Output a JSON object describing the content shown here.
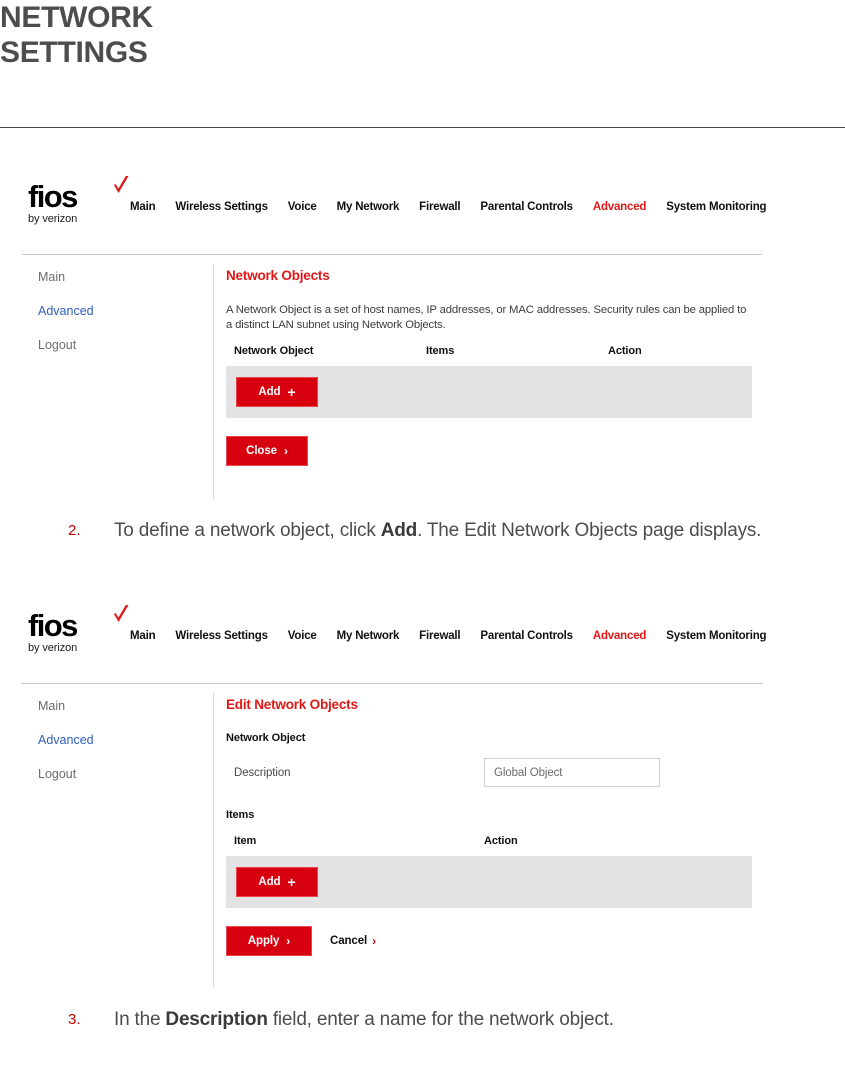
{
  "page": {
    "title_line1": "NETWORK",
    "title_line2": "SETTINGS"
  },
  "router_ui": {
    "logo": {
      "wordmark": "fios",
      "subtext": "by verizon",
      "check_icon": "verizon-check-icon",
      "check_color": "#e01717"
    },
    "nav_items": [
      {
        "label": "Main",
        "active": false
      },
      {
        "label": "Wireless Settings",
        "active": false
      },
      {
        "label": "Voice",
        "active": false
      },
      {
        "label": "My Network",
        "active": false
      },
      {
        "label": "Firewall",
        "active": false
      },
      {
        "label": "Parental Controls",
        "active": false
      },
      {
        "label": "Advanced",
        "active": true
      },
      {
        "label": "System Monitoring",
        "active": false
      }
    ],
    "sidebar_items": [
      {
        "label": "Main",
        "active": false
      },
      {
        "label": "Advanced",
        "active": true
      },
      {
        "label": "Logout",
        "active": false
      }
    ],
    "accent_red": "#e01717",
    "button_red": "#d7000f",
    "active_link_blue": "#2f5fbf",
    "panel_gray": "#e3e3e3"
  },
  "screen1": {
    "title": "Network Objects",
    "description": "A Network Object is a set of host names, IP addresses, or MAC addresses. Security rules can be applied to a distinct LAN subnet using Network Objects.",
    "columns": [
      "Network Object",
      "Items",
      "Action"
    ],
    "rows": [],
    "add_label": "Add",
    "add_icon": "plus-icon",
    "close_label": "Close",
    "close_icon": "chevron-right-icon"
  },
  "screen2": {
    "title": "Edit Network Objects",
    "section_label": "Network Object",
    "description_field_label": "Description",
    "description_field_value": "Global Object",
    "description_field_placeholder": "Global Object",
    "items_label": "Items",
    "columns": [
      "Item",
      "Action"
    ],
    "rows": [],
    "add_label": "Add",
    "add_icon": "plus-icon",
    "apply_label": "Apply",
    "apply_icon": "chevron-right-icon",
    "cancel_label": "Cancel",
    "cancel_icon": "chevron-right-icon"
  },
  "steps": [
    {
      "number": "2.",
      "text_before": "To define a network object, click ",
      "bold": "Add",
      "text_after": ". The Edit Network Objects page displays."
    },
    {
      "number": "3.",
      "text_before": "In the ",
      "bold": "Description",
      "text_after": " field, enter a name for the network object."
    }
  ]
}
